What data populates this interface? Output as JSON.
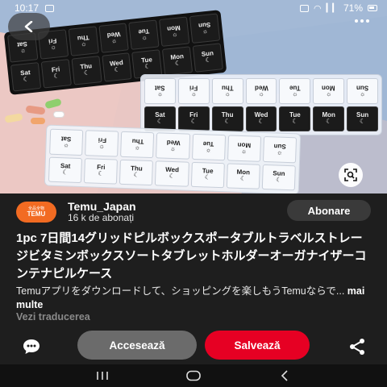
{
  "status_bar": {
    "time": "10:17",
    "battery": "71%"
  },
  "product_image": {
    "organizer_days": [
      "Sat",
      "Fri",
      "Thu",
      "Wed",
      "Tue",
      "Mon",
      "Sun"
    ],
    "top_row_days": [
      "Sat",
      "Fri",
      "Thu",
      "Wed",
      "Tue",
      "Mon",
      "Sun"
    ]
  },
  "channel": {
    "avatar_small": "全品全物",
    "avatar_label": "TEMU",
    "name": "Temu_Japan",
    "subscribers": "16 k de abonați",
    "follow_label": "Abonare"
  },
  "pin": {
    "title": "1pc 7日間14グリッドピルボックスポータブルトラベルストレージビタミンボックスソートタブレットホルダーオーガナイザーコンテナピルケース",
    "description": "Temuアプリをダウンロードして、ショッピングを楽しもうTemuならで...",
    "more_label": "mai multe",
    "translate_label": "Vezi traducerea"
  },
  "actions": {
    "visit_label": "Accesează",
    "save_label": "Salvează"
  },
  "colors": {
    "accent": "#e60023",
    "visit_bg": "#6b6b6b",
    "background": "#1e1e1e",
    "brand_orange": "#f26b22"
  },
  "icons": {
    "back": "chevron-left-icon",
    "more": "more-dots-icon",
    "lens": "visual-search-icon",
    "comment": "comment-bubble-icon",
    "share": "share-icon",
    "nav_recents": "recents-icon",
    "nav_home": "home-icon",
    "nav_back": "back-icon"
  }
}
